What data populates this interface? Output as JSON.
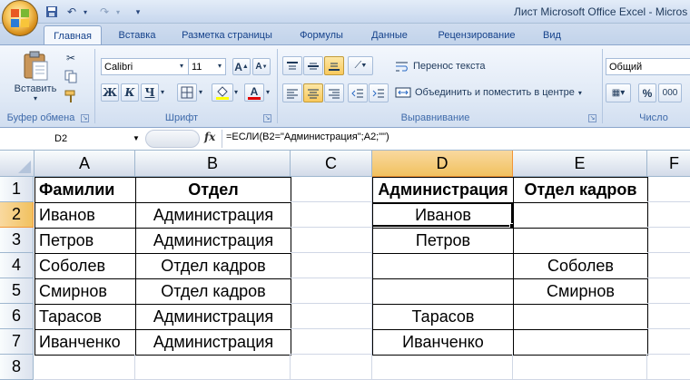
{
  "window": {
    "title": "Лист Microsoft Office Excel - Micros"
  },
  "tabs": [
    "Главная",
    "Вставка",
    "Разметка страницы",
    "Формулы",
    "Данные",
    "Рецензирование",
    "Вид"
  ],
  "clipboard": {
    "paste_label": "Вставить",
    "group_label": "Буфер обмена"
  },
  "font": {
    "name": "Calibri",
    "size": "11",
    "bold": "Ж",
    "italic": "К",
    "underline": "Ч",
    "group_label": "Шрифт",
    "grow": "A",
    "shrink": "A",
    "color_letter": "A"
  },
  "alignment": {
    "wrap_label": "Перенос текста",
    "merge_label": "Объединить и поместить в центре",
    "group_label": "Выравнивание"
  },
  "number": {
    "format": "Общий",
    "percent": "%",
    "thousands": "000",
    "group_label": "Число"
  },
  "formula_bar": {
    "name_box": "D2",
    "fx": "fx",
    "formula": "=ЕСЛИ(B2=\"Администрация\";A2;\"\")"
  },
  "sheet": {
    "columns": [
      "A",
      "B",
      "C",
      "D",
      "E",
      "F"
    ],
    "rows": [
      "1",
      "2",
      "3",
      "4",
      "5",
      "6",
      "7",
      "8"
    ],
    "selected_cell": "D2",
    "cells": [
      [
        "Фамилии",
        "Отдел",
        "",
        "Администрация",
        "Отдел кадров",
        ""
      ],
      [
        "Иванов",
        "Администрация",
        "",
        "Иванов",
        "",
        ""
      ],
      [
        "Петров",
        "Администрация",
        "",
        "Петров",
        "",
        ""
      ],
      [
        "Соболев",
        "Отдел кадров",
        "",
        "",
        "Соболев",
        ""
      ],
      [
        "Смирнов",
        "Отдел кадров",
        "",
        "",
        "Смирнов",
        ""
      ],
      [
        "Тарасов",
        "Администрация",
        "",
        "Тарасов",
        "",
        ""
      ],
      [
        "Иванченко",
        "Администрация",
        "",
        "Иванченко",
        "",
        ""
      ],
      [
        "",
        "",
        "",
        "",
        "",
        ""
      ]
    ]
  },
  "colors": {
    "accent": "#f29536",
    "ribbon": "#dfe8f5",
    "selected_header": "#f9d99f"
  }
}
